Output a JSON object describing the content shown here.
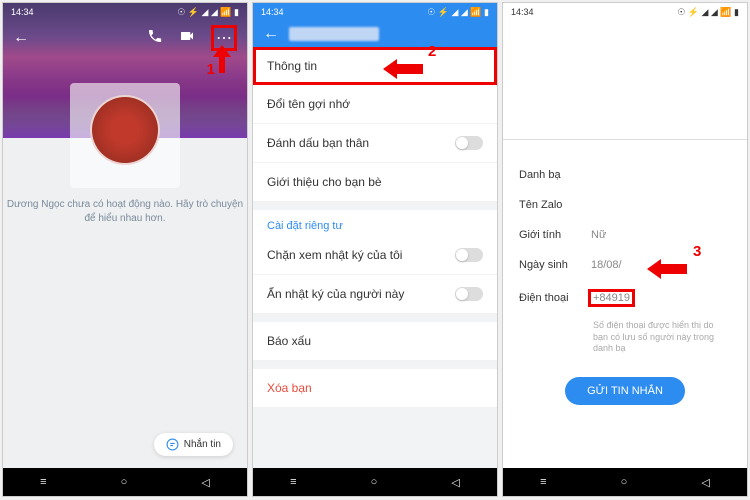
{
  "status": {
    "time": "14:34",
    "bt": "⚡"
  },
  "screen1": {
    "empty_text": "Dương Ngọc chưa có hoạt động nào. Hãy trò chuyện để hiểu nhau hơn.",
    "message_btn": "Nhắn tin",
    "step": "1"
  },
  "screen2": {
    "items": {
      "info": "Thông tin",
      "rename": "Đổi tên gợi nhớ",
      "mark_close": "Đánh dấu bạn thân",
      "introduce": "Giới thiệu cho bạn bè"
    },
    "privacy_label": "Cài đặt riêng tư",
    "privacy": {
      "block_diary": "Chặn xem nhật ký của tôi",
      "hide_diary": "Ẩn nhật ký của người này"
    },
    "report": "Báo xấu",
    "delete_friend": "Xóa bạn",
    "step": "2"
  },
  "screen3": {
    "rows": {
      "contact": {
        "label": "Danh bạ",
        "value": ""
      },
      "zalo_name": {
        "label": "Tên Zalo",
        "value": ""
      },
      "gender": {
        "label": "Giới tính",
        "value": "Nữ"
      },
      "birthday": {
        "label": "Ngày sinh",
        "value": "18/08/"
      },
      "phone": {
        "label": "Điện thoại",
        "value": "+84919"
      }
    },
    "phone_note": "Số điện thoại được hiển thị do bạn có lưu số người này trong danh bạ",
    "send_btn": "GỬI TIN NHẮN",
    "step": "3"
  },
  "nav": {
    "menu": "≡",
    "home": "○",
    "back": "◁"
  }
}
